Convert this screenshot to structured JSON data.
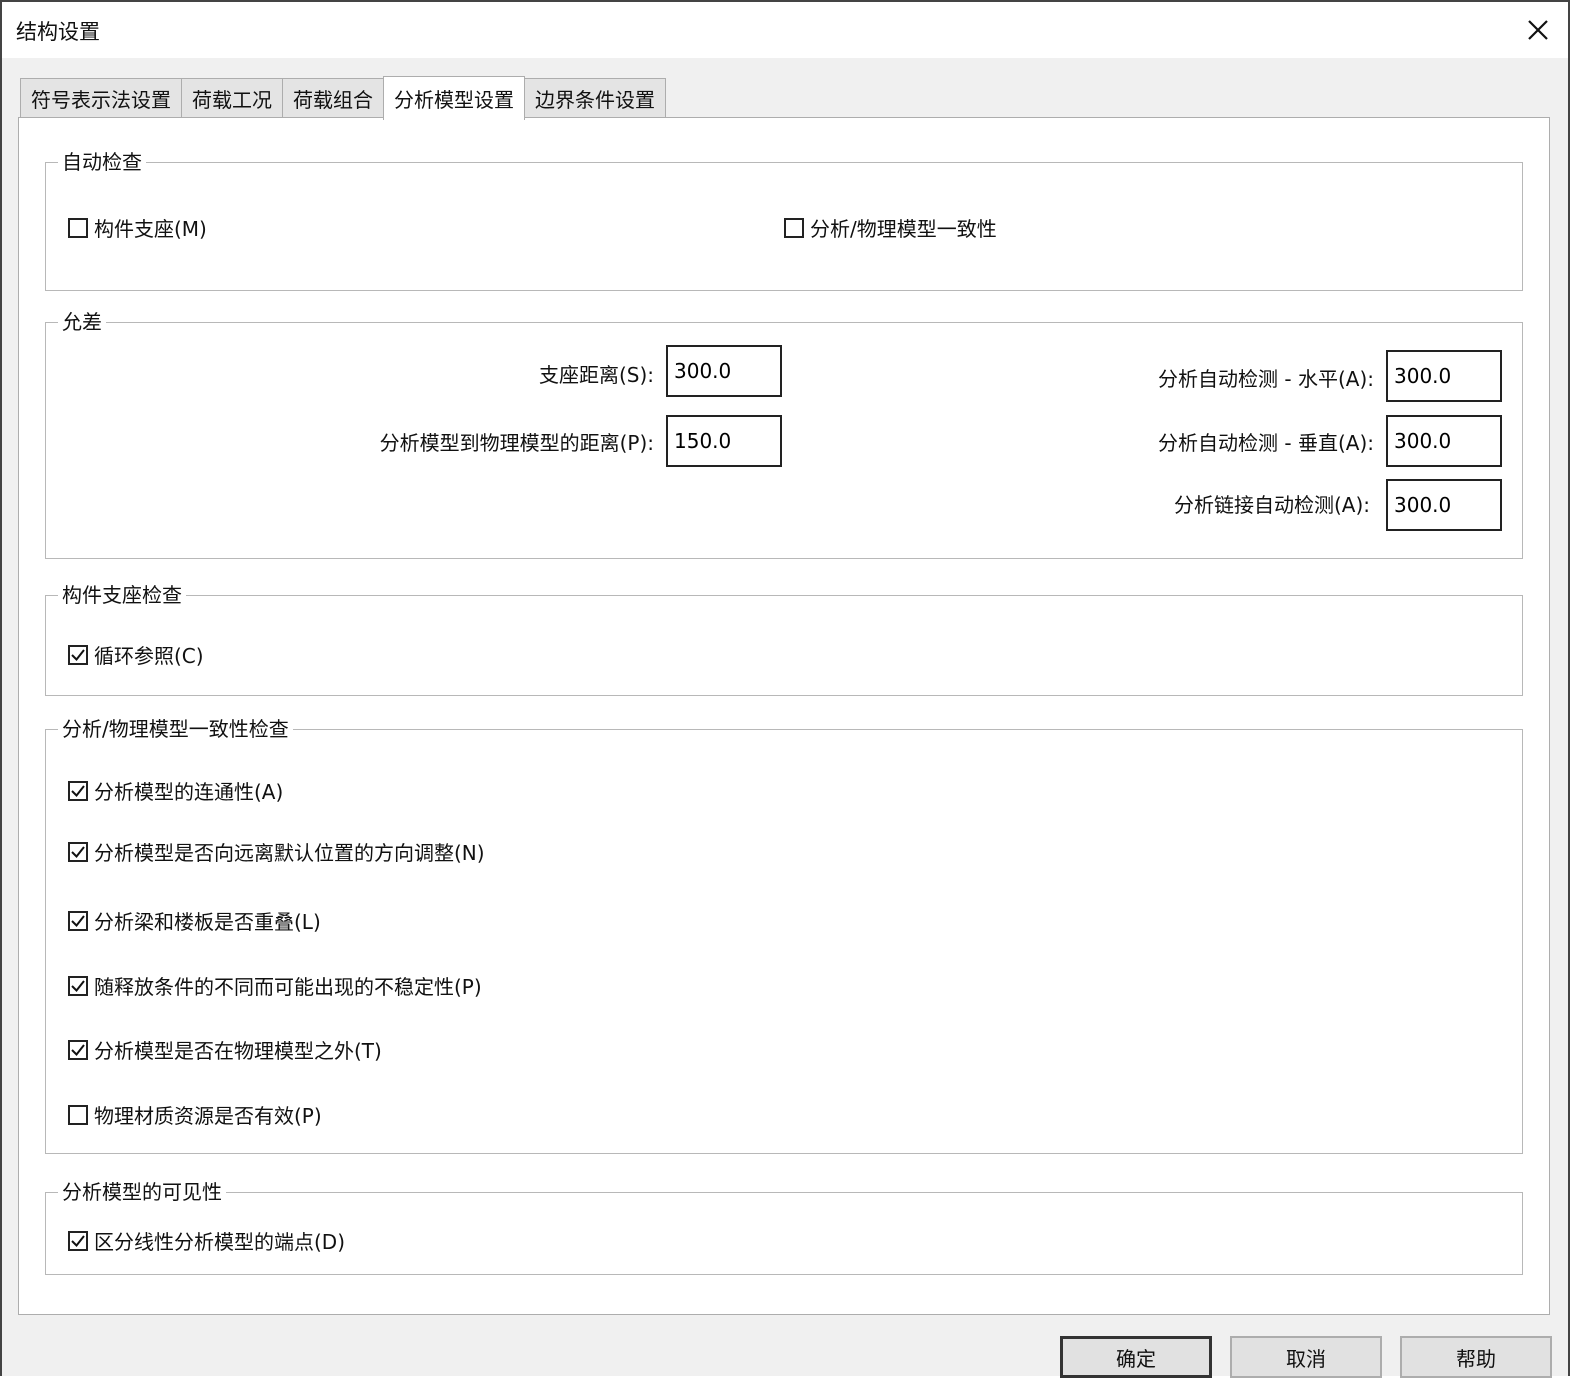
{
  "window": {
    "title": "结构设置",
    "close_icon": "close-icon"
  },
  "tabs": [
    {
      "label": "符号表示法设置",
      "active": false
    },
    {
      "label": "荷载工况",
      "active": false
    },
    {
      "label": "荷载组合",
      "active": false
    },
    {
      "label": "分析模型设置",
      "active": true
    },
    {
      "label": "边界条件设置",
      "active": false
    }
  ],
  "auto_check": {
    "title": "自动检查",
    "member_support": {
      "label": "构件支座(M)",
      "checked": false
    },
    "consistency": {
      "label": "分析/物理模型一致性",
      "checked": false
    }
  },
  "tolerance": {
    "title": "允差",
    "support_distance": {
      "label": "支座距离(S):",
      "value": "300.0"
    },
    "analytical_to_physical": {
      "label": "分析模型到物理模型的距离(P):",
      "value": "150.0"
    },
    "auto_detect_horizontal": {
      "label": "分析自动检测 - 水平(A):",
      "value": "300.0"
    },
    "auto_detect_vertical": {
      "label": "分析自动检测 - 垂直(A):",
      "value": "300.0"
    },
    "link_auto_detect": {
      "label": "分析链接自动检测(A):",
      "value": "300.0"
    }
  },
  "member_support_check": {
    "title": "构件支座检查",
    "circular_reference": {
      "label": "循环参照(C)",
      "checked": true
    }
  },
  "consistency_check": {
    "title": "分析/物理模型一致性检查",
    "items": [
      {
        "label": "分析模型的连通性(A)",
        "checked": true
      },
      {
        "label": "分析模型是否向远离默认位置的方向调整(N)",
        "checked": true
      },
      {
        "label": "分析梁和楼板是否重叠(L)",
        "checked": true
      },
      {
        "label": "随释放条件的不同而可能出现的不稳定性(P)",
        "checked": true
      },
      {
        "label": "分析模型是否在物理模型之外(T)",
        "checked": true
      },
      {
        "label": "物理材质资源是否有效(P)",
        "checked": false
      }
    ]
  },
  "visibility": {
    "title": "分析模型的可见性",
    "endpoints": {
      "label": "区分线性分析模型的端点(D)",
      "checked": true
    }
  },
  "buttons": {
    "ok": "确定",
    "cancel": "取消",
    "help": "帮助"
  }
}
